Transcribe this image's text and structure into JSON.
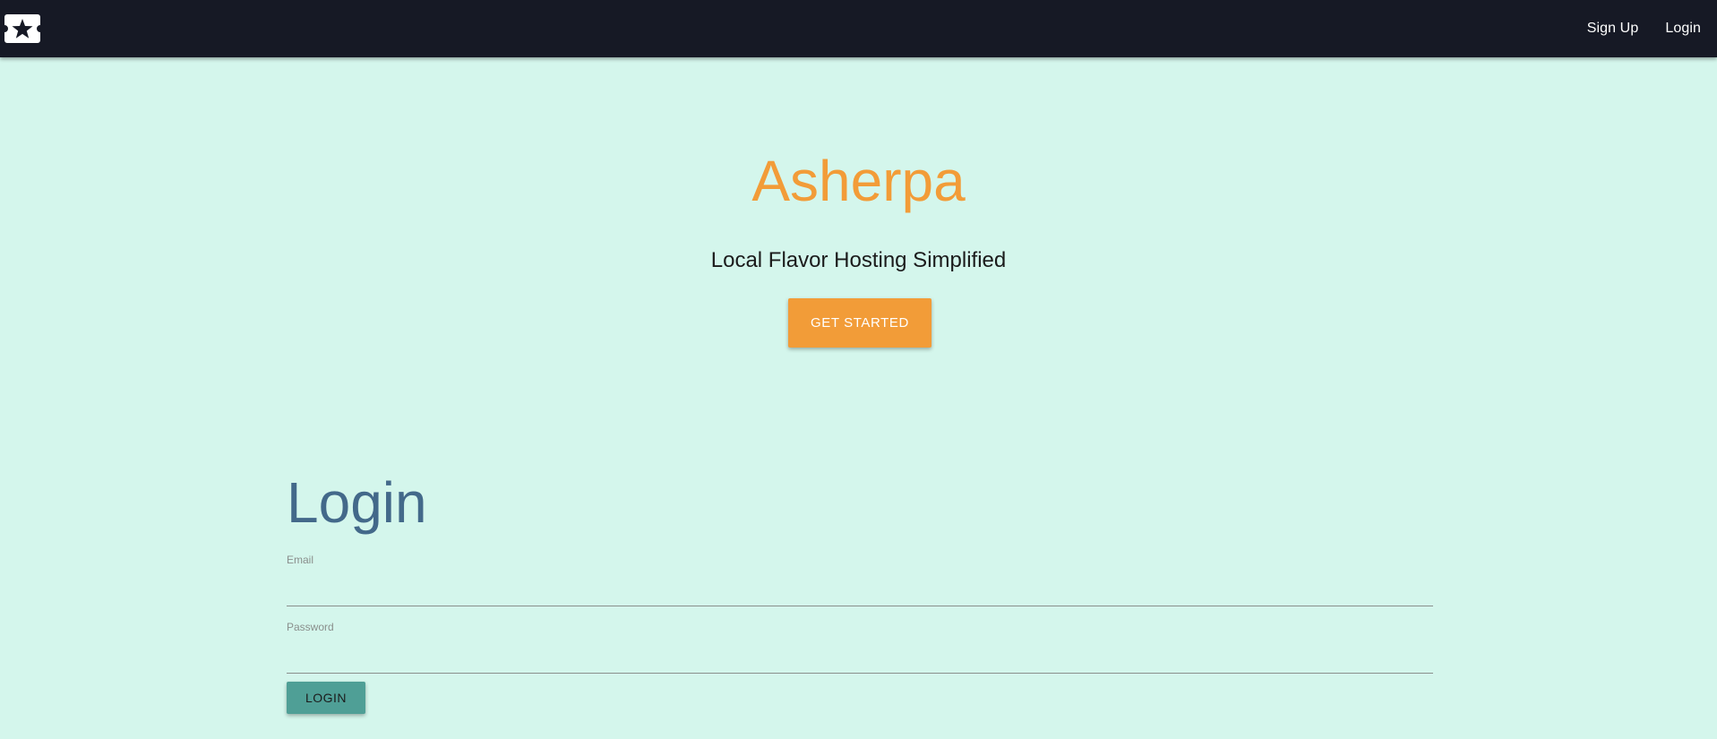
{
  "colors": {
    "navbar_bg": "#161925",
    "page_bg": "#d4f6ec",
    "brand_accent": "#f29c38",
    "heading": "#43698a",
    "login_button": "#4f9f96"
  },
  "navbar": {
    "logo_icon": "ticket-star-icon",
    "links": [
      {
        "label": "Sign Up"
      },
      {
        "label": "Login"
      }
    ]
  },
  "hero": {
    "title": "Asherpa",
    "tagline": "Local Flavor Hosting Simplified",
    "cta_label": "GET STARTED"
  },
  "login_form": {
    "heading": "Login",
    "email_label": "Email",
    "email_value": "",
    "password_label": "Password",
    "password_value": "",
    "submit_label": "LOGIN"
  }
}
